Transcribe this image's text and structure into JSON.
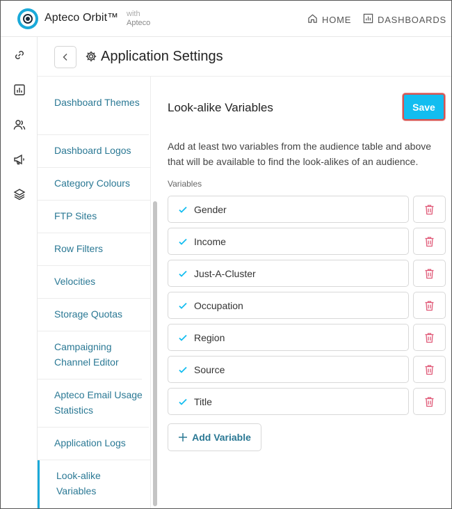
{
  "header": {
    "brand": "Apteco Orbit™",
    "with_line1": "with",
    "with_line2": "Apteco",
    "nav": [
      {
        "label": "HOME",
        "icon": "home-icon"
      },
      {
        "label": "DASHBOARDS",
        "icon": "dashboards-icon"
      }
    ]
  },
  "rail": {
    "icons": [
      "link-icon",
      "chart-icon",
      "users-icon",
      "megaphone-icon",
      "layers-icon"
    ]
  },
  "page": {
    "title": "Application Settings"
  },
  "settings_nav": {
    "items": [
      {
        "label": "Dashboard Themes"
      },
      {
        "label": "Dashboard Logos"
      },
      {
        "label": "Category Colours"
      },
      {
        "label": "FTP Sites"
      },
      {
        "label": "Row Filters"
      },
      {
        "label": "Velocities"
      },
      {
        "label": "Storage Quotas"
      },
      {
        "label": "Campaigning Channel Editor"
      },
      {
        "label": "Apteco Email Usage Statistics"
      },
      {
        "label": "Application Logs"
      },
      {
        "label": "Look-alike Variables",
        "active": true
      }
    ]
  },
  "main": {
    "section_title": "Look-alike Variables",
    "save_label": "Save",
    "description": "Add at least two variables from the audience table and above that will be available to find the look-alikes of an audience.",
    "variables_label": "Variables",
    "variables": [
      "Gender",
      "Income",
      "Just-A-Cluster",
      "Occupation",
      "Region",
      "Source",
      "Title"
    ],
    "add_label": "Add Variable"
  },
  "colors": {
    "accent": "#13bdf0",
    "link": "#2a7894",
    "delete": "#e05a78",
    "highlight_border": "#d9534f"
  }
}
